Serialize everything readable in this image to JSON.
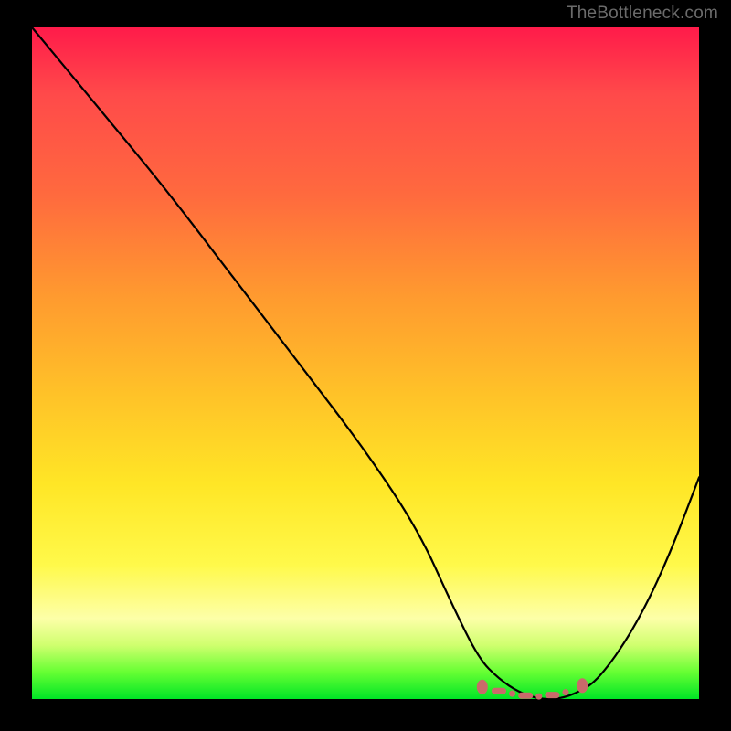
{
  "attribution": "TheBottleneck.com",
  "chart_data": {
    "type": "line",
    "title": "",
    "xlabel": "",
    "ylabel": "",
    "xlim": [
      0,
      100
    ],
    "ylim": [
      0,
      100
    ],
    "series": [
      {
        "name": "bottleneck-curve",
        "x": [
          0,
          5,
          10,
          20,
          30,
          40,
          50,
          58,
          63,
          67,
          70,
          73,
          76,
          79,
          82,
          85,
          90,
          95,
          100
        ],
        "values": [
          100,
          94,
          88,
          76,
          63,
          50,
          37,
          25,
          14,
          6,
          3,
          1,
          0,
          0,
          1,
          3,
          10,
          20,
          33
        ]
      }
    ],
    "markers": {
      "name": "optimal-zone-markers",
      "x": [
        67.5,
        70,
        72,
        74,
        76,
        78,
        80,
        82.5
      ],
      "values": [
        1.8,
        1.2,
        0.8,
        0.5,
        0.4,
        0.6,
        1.0,
        2.0
      ]
    },
    "gradient": {
      "top": "#ff1b4a",
      "mid_upper": "#ff9a2f",
      "mid": "#ffe626",
      "mid_lower": "#fdffa8",
      "bottom": "#00e526"
    }
  }
}
